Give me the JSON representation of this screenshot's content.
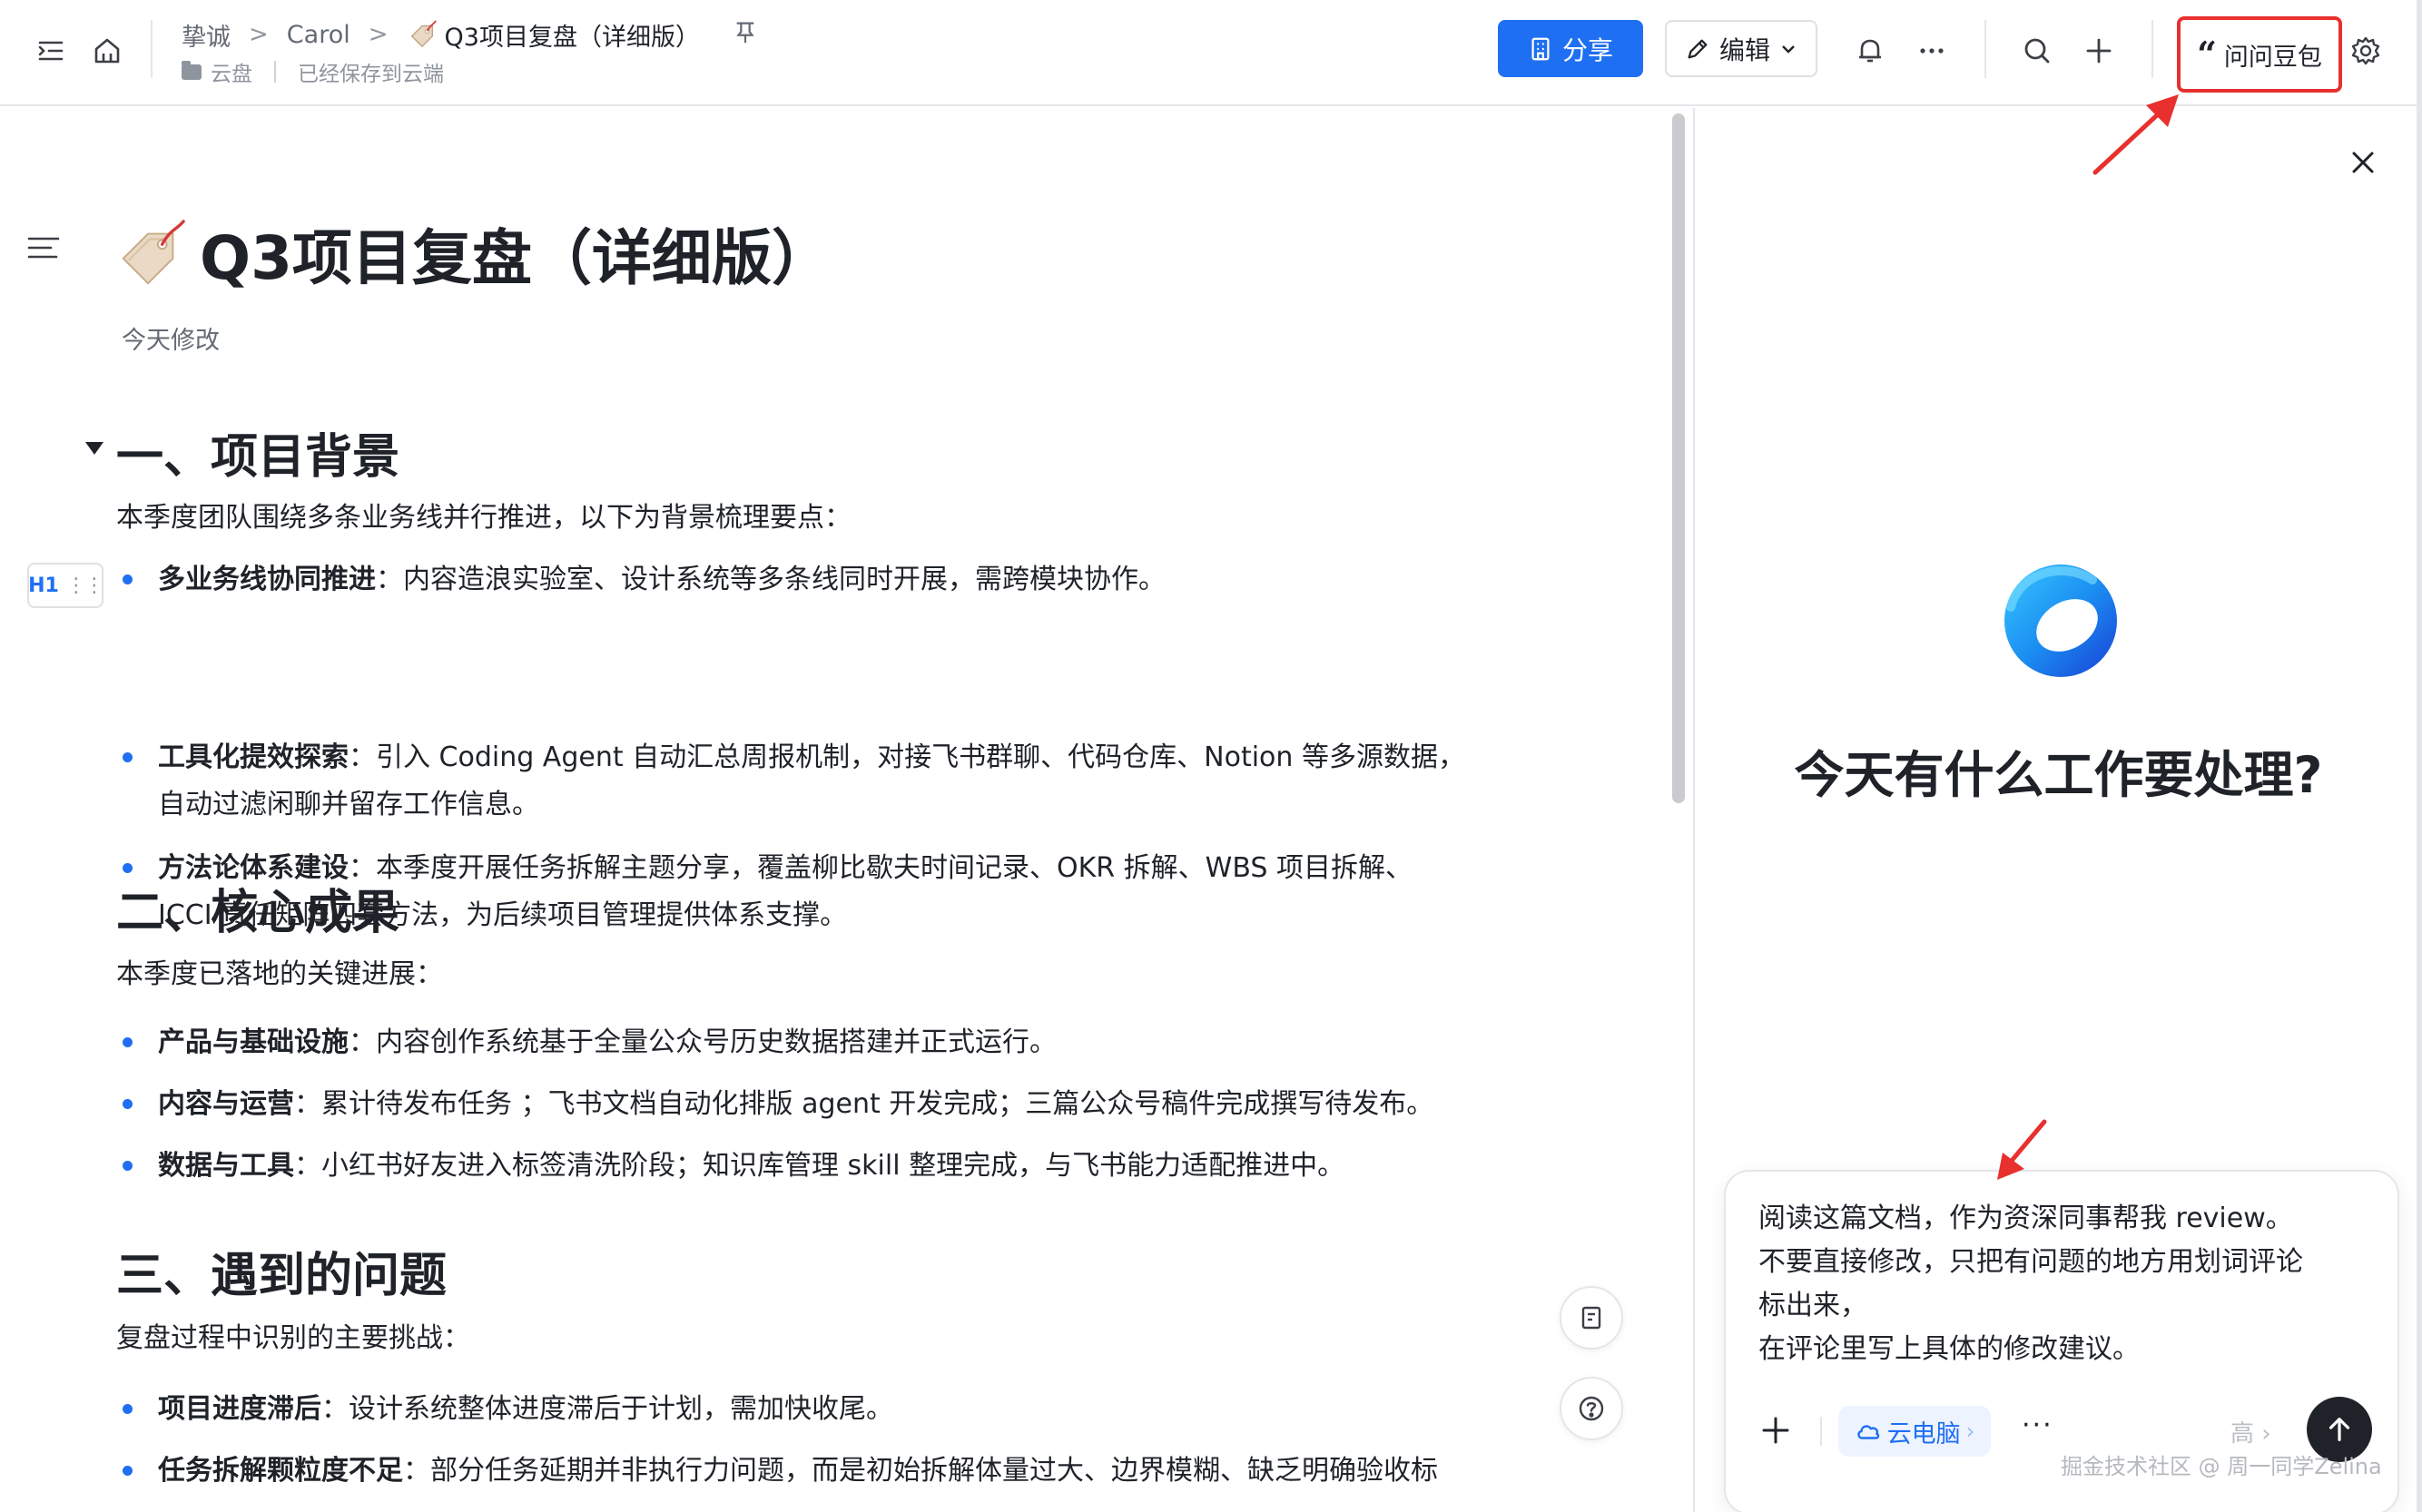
{
  "topbar": {
    "breadcrumb": [
      "挚诚",
      "Carol"
    ],
    "doc_name": "Q3项目复盘（详细版）",
    "location": "云盘",
    "save_status": "已经保存到云端",
    "share_label": "分享",
    "edit_label": "编辑",
    "ask_label": "问问豆包"
  },
  "doc": {
    "title": "Q3项目复盘（详细版）",
    "modified": "今天修改",
    "block_badge": "H1",
    "sections": [
      {
        "heading": "一、项目背景",
        "intro": "本季度团队围绕多条业务线并行推进，以下为背景梳理要点：",
        "items": [
          {
            "label": "多业务线协同推进",
            "text": "：内容造浪实验室、设计系统等多条线同时开展，需跨模块协作。"
          },
          {
            "label": "工具化提效探索",
            "text_line1": "：引入 Coding Agent 自动汇总周报机制，对接飞书群聊、代码仓库、Notion 等多源数据，",
            "text_line2": "自动过滤闲聊并留存工作信息。"
          },
          {
            "label": "方法论体系建设",
            "text_line1": "：本季度开展任务拆解主题分享，覆盖柳比歇夫时间记录、OKR 拆解、WBS 项目拆解、",
            "text_line2": "ICCI 责任矩阵四套方法，为后续项目管理提供体系支撑。"
          }
        ]
      },
      {
        "heading": "二、核心成果",
        "intro": "本季度已落地的关键进展：",
        "items": [
          {
            "label": "产品与基础设施",
            "text": "：内容创作系统基于全量公众号历史数据搭建并正式运行。"
          },
          {
            "label": "内容与运营",
            "text": "：累计待发布任务 ；飞书文档自动化排版 agent 开发完成；三篇公众号稿件完成撰写待发布。"
          },
          {
            "label": "数据与工具",
            "text": "：小红书好友进入标签清洗阶段；知识库管理 skill 整理完成，与飞书能力适配推进中。"
          }
        ]
      },
      {
        "heading": "三、遇到的问题",
        "intro": "复盘过程中识别的主要挑战：",
        "items": [
          {
            "label": "项目进度滞后",
            "text": "：设计系统整体进度滞后于计划，需加快收尾。"
          },
          {
            "label": "任务拆解颗粒度不足",
            "text": "：部分任务延期并非执行力问题，而是初始拆解体量过大、边界模糊、缺乏明确验收标"
          }
        ]
      }
    ]
  },
  "panel": {
    "heading": "今天有什么工作要处理?",
    "prompt_lines": [
      "阅读这篇文档，作为资深同事帮我 review。",
      "不要直接修改，只把有问题的地方用划词评论",
      "标出来，",
      "在评论里写上具体的修改建议。"
    ],
    "cloud_pc_label": "云电脑",
    "level_label": "高",
    "more_label": "···"
  },
  "watermark": "掘金技术社区 @ 周一同学Zelina",
  "colors": {
    "accent": "#1f6ff2",
    "annotation": "#e8302e",
    "text": "#1f2329",
    "muted": "#646a73"
  }
}
